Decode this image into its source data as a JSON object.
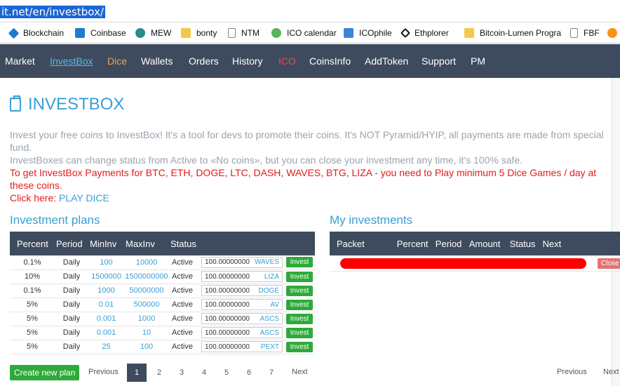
{
  "browser": {
    "url": "it.net/en/investbox/"
  },
  "bookmarks": [
    {
      "label": "Blockchain",
      "icon": "blockchain-icon",
      "color": "#1f7ad6"
    },
    {
      "label": "Coinbase",
      "icon": "coinbase-icon",
      "color": "#1f7ad6"
    },
    {
      "label": "MEW",
      "icon": "mew-icon",
      "color": "#2b8a8a"
    },
    {
      "label": "bonty",
      "icon": "folder-icon",
      "color": "#f2c94c"
    },
    {
      "label": "NTM",
      "icon": "page-icon",
      "color": "#888888"
    },
    {
      "label": "ICO calendar",
      "icon": "ico-calendar-icon",
      "color": "#5ab55a"
    },
    {
      "label": "ICOphile",
      "icon": "icophile-icon",
      "color": "#3a86d6"
    },
    {
      "label": "Ethplorer",
      "icon": "ethplorer-icon",
      "color": "#111111"
    },
    {
      "label": "Bitcoin-Lumen Progra",
      "icon": "folder-icon",
      "color": "#f2c94c"
    },
    {
      "label": "FBF",
      "icon": "page-icon",
      "color": "#888888"
    },
    {
      "label": "",
      "icon": "bitcoin-icon",
      "color": "#f7931a"
    }
  ],
  "nav": [
    "Market",
    "InvestBox",
    "Dice",
    "Wallets",
    "Orders",
    "History",
    "ICO",
    "CoinsInfo",
    "AddToken",
    "Support",
    "PM"
  ],
  "page": {
    "title": "INVESTBOX",
    "desc1": "Invest your free coins to InvestBox! It's a tool for devs to promote their coins. It's NOT Pyramid/HYIP, all payments are made from special fund.",
    "desc2": "InvestBoxes can change status from Active to «No coins», but you can close your investment any time, it's 100% safe.",
    "desc3": "To get InvestBox Payments for BTC, ETH, DOGE, LTC, DASH, WAVES, BTG, LIZA - you need to Play minimum 5 Dice Games / day at these coins.",
    "click_here": "Click here: ",
    "play_dice": "PLAY DICE"
  },
  "plans": {
    "heading": "Investment plans",
    "columns": [
      "Percent",
      "Period",
      "MinInv",
      "MaxInv",
      "Status"
    ],
    "rows": [
      {
        "percent": "0.1%",
        "period": "Daily",
        "min": "100",
        "max": "10000",
        "status": "Active",
        "amount": "100.00000000",
        "coin": "WAVES",
        "btn": "Invest"
      },
      {
        "percent": "10%",
        "period": "Daily",
        "min": "1500000",
        "max": "1500000000",
        "status": "Active",
        "amount": "100.00000000",
        "coin": "LIZA",
        "btn": "Invest"
      },
      {
        "percent": "0.1%",
        "period": "Daily",
        "min": "1000",
        "max": "50000000",
        "status": "Active",
        "amount": "100.00000000",
        "coin": "DOGE",
        "btn": "Invest"
      },
      {
        "percent": "5%",
        "period": "Daily",
        "min": "0.01",
        "max": "500000",
        "status": "Active",
        "amount": "100.00000000",
        "coin": "AV",
        "btn": "Invest"
      },
      {
        "percent": "5%",
        "period": "Daily",
        "min": "0.001",
        "max": "1000",
        "status": "Active",
        "amount": "100.00000000",
        "coin": "ASCS",
        "btn": "Invest"
      },
      {
        "percent": "5%",
        "period": "Daily",
        "min": "0.001",
        "max": "10",
        "status": "Active",
        "amount": "100.00000000",
        "coin": "ASCS",
        "btn": "Invest"
      },
      {
        "percent": "5%",
        "period": "Daily",
        "min": "25",
        "max": "100",
        "status": "Active",
        "amount": "100.00000000",
        "coin": "PEXT",
        "btn": "Invest"
      }
    ],
    "create_btn": "Create new plan",
    "prev": "Previous",
    "next": "Next",
    "pages": [
      "1",
      "2",
      "3",
      "4",
      "5",
      "6",
      "7"
    ]
  },
  "my": {
    "heading": "My investments",
    "columns": [
      "Packet",
      "Percent",
      "Period",
      "Amount",
      "Status",
      "Next"
    ],
    "close_btn": "Close",
    "prev": "Previous",
    "next": "Next",
    "redaction_color": "#ff0000"
  }
}
